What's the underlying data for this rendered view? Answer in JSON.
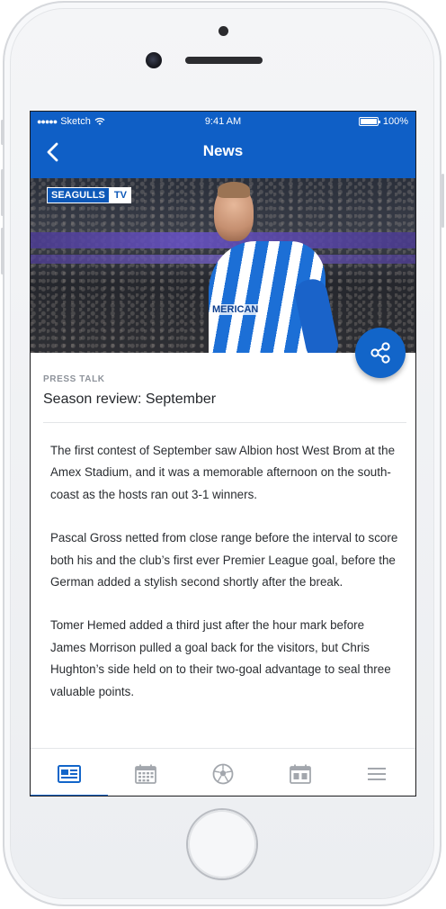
{
  "status_bar": {
    "carrier": "Sketch",
    "time": "9:41 AM",
    "battery": "100%"
  },
  "nav": {
    "title": "News",
    "back_icon": "chevron-left-icon"
  },
  "hero": {
    "tag_left": "SEAGULLS",
    "tag_right": "TV",
    "sponsor_text": "MERICAN"
  },
  "share": {
    "icon": "share-icon"
  },
  "article": {
    "kicker": "PRESS TALK",
    "title": "Season review: September",
    "paragraphs": [
      "The first contest of September saw Albion host West Brom at the Amex Stadium, and it was a memorable afternoon on the south-coast as the hosts ran out 3-1 winners.",
      "Pascal Gross netted from close range before the interval to score both his and the club’s first ever Premier League goal, before the German added a stylish second shortly after the break.",
      "Tomer Hemed added a third just after the hour mark before James Morrison pulled a goal back for the visitors, but Chris Hughton’s side held on to their two-goal advantage to seal three valuable points."
    ]
  },
  "tabs": [
    {
      "icon": "news-icon",
      "active": true
    },
    {
      "icon": "calendar-icon",
      "active": false
    },
    {
      "icon": "football-icon",
      "active": false
    },
    {
      "icon": "fixtures-icon",
      "active": false
    },
    {
      "icon": "menu-icon",
      "active": false
    }
  ],
  "colors": {
    "brand_blue": "#0f5fc6",
    "accent_blue": "#1265c9",
    "muted_gray": "#8e939b",
    "tab_inactive": "#a3a7ad"
  }
}
